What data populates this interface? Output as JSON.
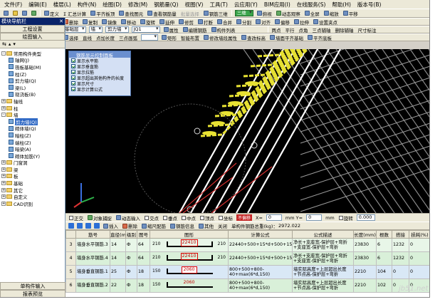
{
  "menu": [
    "文件(F)",
    "编辑(E)",
    "楼层(L)",
    "构件(N)",
    "绘图(D)",
    "修改(M)",
    "钢筋量(Q)",
    "视图(V)",
    "工具(T)",
    "云应用(Y)",
    "BIM应用(I)",
    "在线服务(S)",
    "帮助(H)",
    "版本号(B)"
  ],
  "toolbar1": {
    "items": [
      "定义",
      "Σ 汇总计算",
      "平齐板顶",
      "查找图元",
      "查看钢筋量",
      "批量选择",
      "钢筋三维"
    ],
    "view_combo": "三维",
    "right_items": [
      "俯视",
      "动态观察",
      "全屏",
      "缩放",
      "平移"
    ]
  },
  "toolbar2": [
    "删除",
    "复制",
    "镜像",
    "移动",
    "旋转",
    "延伸",
    "修剪",
    "打断",
    "合并",
    "分割",
    "对齐",
    "偏移",
    "拉伸",
    "设置夹点"
  ],
  "toolbar3": {
    "floor_combo": "基础层",
    "type_combo": "墙",
    "sub_combo": "剪力墙",
    "name_combo": "JQ1",
    "items": [
      "属性",
      "编辑钢筋",
      "构件列表"
    ],
    "right_items": [
      "两点",
      "平行",
      "点角",
      "三点辅轴",
      "删除辅轴",
      "尺寸标注"
    ]
  },
  "toolbar4": {
    "items": [
      "选择",
      "直线",
      "点加长度",
      "三点画弧"
    ],
    "right_items": [
      "矩形",
      "智能布置",
      "修改墙段属性",
      "查改标高",
      "墙面平齐基础",
      "平齐底板"
    ]
  },
  "left_panel": {
    "title": "模块导航栏",
    "btn_settings": "工程设置",
    "btn_draw": "绘图输入",
    "tree": [
      {
        "label": "常用构件类型",
        "level": 0,
        "kind": "folder",
        "exp": "-"
      },
      {
        "label": "轴网(J)",
        "level": 1,
        "kind": "leaf"
      },
      {
        "label": "筏板基础(M)",
        "level": 1,
        "kind": "leaf"
      },
      {
        "label": "柱(Z)",
        "level": 1,
        "kind": "leaf"
      },
      {
        "label": "剪力墙(Q)",
        "level": 1,
        "kind": "leaf"
      },
      {
        "label": "梁(L)",
        "level": 1,
        "kind": "leaf"
      },
      {
        "label": "现浇板(B)",
        "level": 1,
        "kind": "leaf"
      },
      {
        "label": "轴线",
        "level": 0,
        "kind": "folder",
        "exp": "+"
      },
      {
        "label": "柱",
        "level": 0,
        "kind": "folder",
        "exp": "+"
      },
      {
        "label": "墙",
        "level": 0,
        "kind": "folder",
        "exp": "-"
      },
      {
        "label": "剪力墙(Q)",
        "level": 1,
        "kind": "leaf",
        "selected": true
      },
      {
        "label": "砌体墙(Q)",
        "level": 1,
        "kind": "leaf"
      },
      {
        "label": "暗柱(Z)",
        "level": 1,
        "kind": "leaf"
      },
      {
        "label": "端柱(Z)",
        "level": 1,
        "kind": "leaf"
      },
      {
        "label": "暗梁(A)",
        "level": 1,
        "kind": "leaf"
      },
      {
        "label": "砌体加筋(Y)",
        "level": 1,
        "kind": "leaf"
      },
      {
        "label": "门窗洞",
        "level": 0,
        "kind": "folder",
        "exp": "+"
      },
      {
        "label": "梁",
        "level": 0,
        "kind": "folder",
        "exp": "+"
      },
      {
        "label": "板",
        "level": 0,
        "kind": "folder",
        "exp": "+"
      },
      {
        "label": "基础",
        "level": 0,
        "kind": "folder",
        "exp": "+"
      },
      {
        "label": "其它",
        "level": 0,
        "kind": "folder",
        "exp": "+"
      },
      {
        "label": "自定义",
        "level": 0,
        "kind": "folder",
        "exp": "+"
      },
      {
        "label": "CAD识别",
        "level": 0,
        "kind": "folder",
        "exp": "+"
      }
    ],
    "btn_single": "单构件输入",
    "btn_report": "报表预览"
  },
  "control_panel": {
    "title": "钢筋显示控制面板",
    "rows": [
      "显示水平筋",
      "显示垂直筋",
      "显示拉筋",
      "显示超出其他构件的长度",
      "显示尺寸",
      "显示计算公式"
    ]
  },
  "status_bar": {
    "items": [
      "正交",
      "对象捕捉",
      "动态输入",
      "交点",
      "垂点",
      "中点",
      "顶点",
      "坐标"
    ],
    "no_offset": "不偏移",
    "x_label": "X=",
    "x_value": "0",
    "y_label": "mm Y=",
    "y_value": "0",
    "unit": "mm",
    "rotate_label": "旋转",
    "rotate_value": "0.000"
  },
  "rebar_toolbar": {
    "items": [
      "插入",
      "删除",
      "缩尺配筋",
      "钢筋信息",
      "其他",
      "关闭"
    ],
    "total_label": "单构件钢筋总重(kg)：",
    "total_value": "2972.022"
  },
  "grid": {
    "columns": [
      "",
      "筋号",
      "直径(mm)",
      "级别",
      "图号",
      "图形",
      "计算公式",
      "公式描述",
      "长度(mm)",
      "根数",
      "搭接",
      "损耗(%)"
    ],
    "rows": [
      {
        "num": "3",
        "name": "墙身水平钢筋.3",
        "dia": "14",
        "grade": "Ф",
        "code": "64",
        "left": "210",
        "mid": "22410",
        "right": "210",
        "formula": "22440+500+15*d+500+15*d+5*d",
        "desc": "净长+支座宽-保护层+弯折+支座宽-保护层+弯折",
        "len": "23830",
        "count": "6",
        "lap": "1232",
        "loss": "0"
      },
      {
        "num": "4",
        "name": "墙身水平钢筋.4",
        "dia": "14",
        "grade": "Ф",
        "code": "64",
        "left": "210",
        "mid": "22410",
        "right": "210",
        "formula": "22440+500+15*d+500+15*d+5*d",
        "desc": "净长+支座宽-保护层+弯折+支座宽-保护层+弯折",
        "len": "23830",
        "count": "6",
        "lap": "1232",
        "loss": "0"
      },
      {
        "num": "5",
        "name": "墙身垂直钢筋.1",
        "dia": "25",
        "grade": "Ф",
        "code": "18",
        "left": "150",
        "mid": "2060",
        "right": "",
        "formula": "800+500+800-40+max(6*d,150)",
        "desc": "墙实际高度+上层超出长度+节点高-保护层+弯折",
        "len": "2210",
        "count": "104",
        "lap": "0",
        "loss": "0"
      },
      {
        "num": "6",
        "name": "墙身垂直钢筋.2",
        "dia": "22",
        "grade": "Ф",
        "code": "18",
        "left": "150",
        "mid": "2060",
        "right": "",
        "formula": "800+500+800-40+max(6*d,150)",
        "desc": "墙实际高度+上层超出长度+节点高-保护层+弯折",
        "len": "2210",
        "count": "102",
        "lap": "0",
        "loss": "0"
      }
    ]
  },
  "colors": {
    "viewport_bg": "#000000",
    "rebar_yellow": "#e8e233",
    "rebar_white": "#ffffff",
    "annotation_red": "#d32f2f",
    "selection_blue": "#316ac5"
  }
}
